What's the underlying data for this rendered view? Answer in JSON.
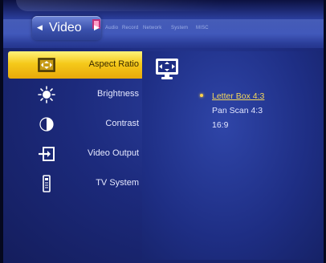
{
  "top_tabs": {
    "active": "Video",
    "others": [
      "Audio",
      "Record",
      "Network",
      "System",
      "MISC"
    ]
  },
  "sidebar": {
    "items": [
      {
        "label": "Aspect Ratio",
        "icon": "aspect-ratio-icon",
        "selected": true
      },
      {
        "label": "Brightness",
        "icon": "brightness-icon",
        "selected": false
      },
      {
        "label": "Contrast",
        "icon": "contrast-icon",
        "selected": false
      },
      {
        "label": "Video Output",
        "icon": "video-output-icon",
        "selected": false
      },
      {
        "label": "TV System",
        "icon": "tv-system-icon",
        "selected": false
      }
    ]
  },
  "panel": {
    "icon": "monitor-icon",
    "options": [
      {
        "label": "Letter Box 4:3",
        "selected": true
      },
      {
        "label": "Pan Scan 4:3",
        "selected": false
      },
      {
        "label": "16:9",
        "selected": false
      }
    ]
  },
  "colors": {
    "highlight": "#f5c91a",
    "background": "#1c2a7c",
    "selected_option": "#f5d85a"
  }
}
